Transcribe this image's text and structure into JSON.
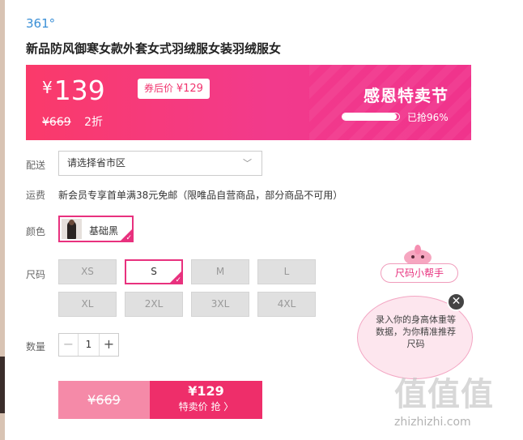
{
  "product": {
    "brand": "361°",
    "title": "新品防风御寒女款外套女式羽绒服女装羽绒服女"
  },
  "price_banner": {
    "currency": "¥",
    "price": "139",
    "coupon_label": "券后价",
    "coupon_price": "¥129",
    "original_price": "¥669",
    "discount": "2折",
    "promo_title": "感恩特卖节",
    "progress_percent": 96,
    "progress_text": "已抢96%",
    "colors": {
      "start": "#fa3a6a",
      "end": "#f0338c"
    }
  },
  "delivery": {
    "label": "配送",
    "select_value": "请选择省市区"
  },
  "shipping": {
    "label": "运费",
    "text": "新会员专享首单满38元免邮（限唯品自营商品，部分商品不可用）"
  },
  "color": {
    "label": "颜色",
    "options": [
      {
        "label": "基础黑",
        "selected": true
      }
    ]
  },
  "size": {
    "label": "尺码",
    "options": [
      {
        "label": "XS",
        "selected": false
      },
      {
        "label": "S",
        "selected": true
      },
      {
        "label": "M",
        "selected": false
      },
      {
        "label": "L",
        "selected": false
      },
      {
        "label": "XL",
        "selected": false
      },
      {
        "label": "2XL",
        "selected": false
      },
      {
        "label": "3XL",
        "selected": false
      },
      {
        "label": "4XL",
        "selected": false
      }
    ]
  },
  "quantity": {
    "label": "数量",
    "value": "1",
    "minus": "−",
    "plus": "+"
  },
  "buy_bar": {
    "original_price": "¥669",
    "sale_price": "¥129",
    "action_label": "特卖价 抢 〉"
  },
  "size_helper": {
    "tag": "尺码小帮手",
    "bubble_text": "录入你的身高体重等数据，为你精准推荐尺码",
    "close": "✕"
  },
  "watermark": {
    "logo": "值值值",
    "url": "zhizhizhi.com"
  },
  "theme": {
    "accent": "#e8317e",
    "link": "#3a8fd6"
  }
}
